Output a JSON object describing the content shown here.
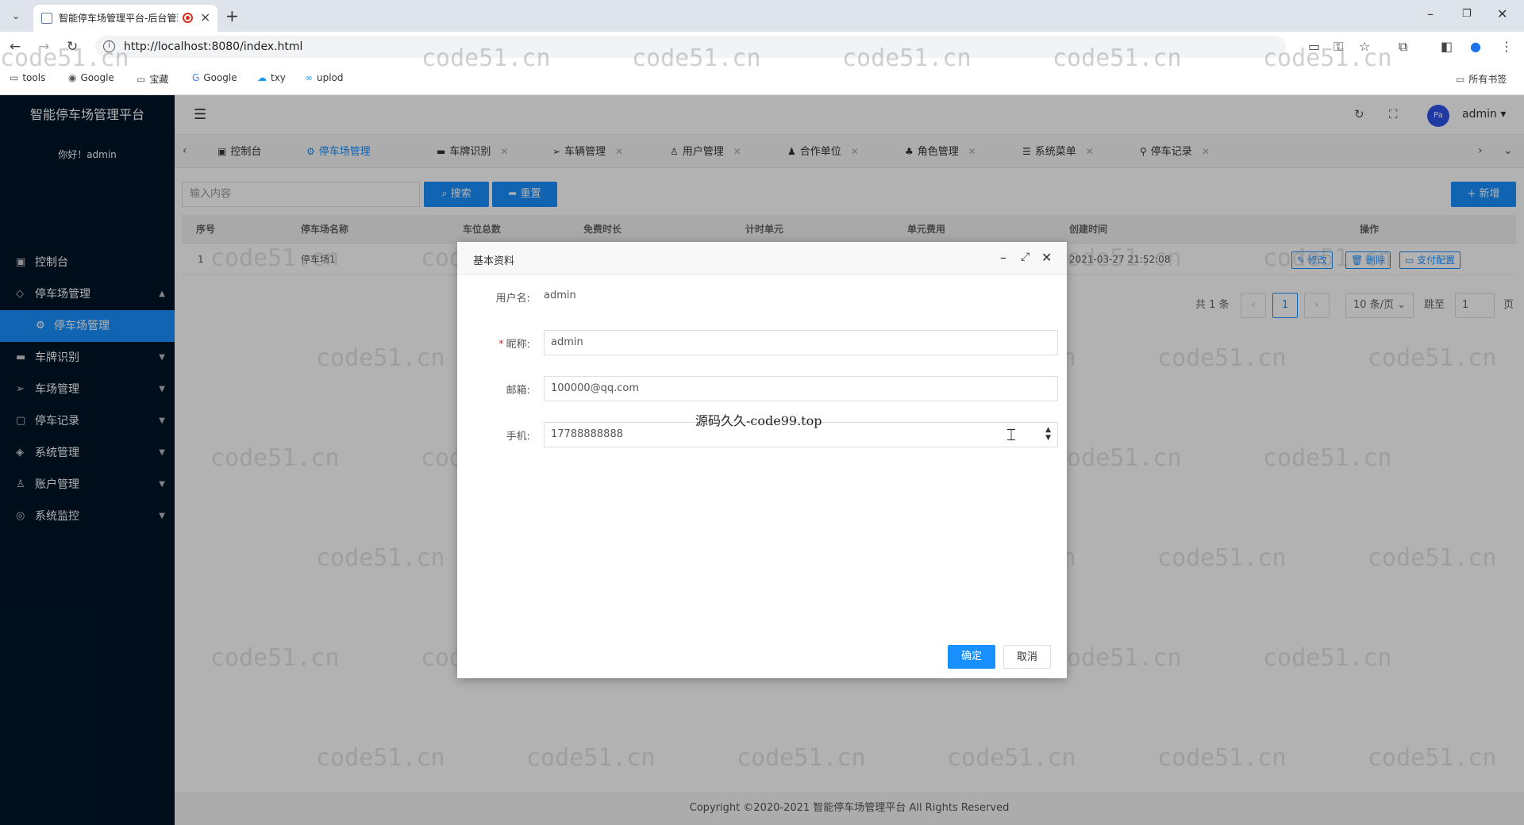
{
  "browser": {
    "tab_title": "智能停车场管理平台-后台管理",
    "url": "http://localhost:8080/index.html",
    "bookmarks": [
      "tools",
      "Google",
      "宝藏",
      "Google",
      "txy",
      "uplod"
    ],
    "all_bookmarks": "所有书签"
  },
  "app": {
    "logo": "智能停车场管理平台",
    "greeting": "你好！admin",
    "username": "admin",
    "avatar_text": "Pa"
  },
  "sidebar": {
    "items": [
      {
        "label": "控制台",
        "icon": "monitor-icon"
      },
      {
        "label": "停车场管理",
        "icon": "diamond-icon"
      },
      {
        "label": "停车场管理",
        "icon": "gear-icon"
      },
      {
        "label": "车牌识别",
        "icon": "camera-icon"
      },
      {
        "label": "车场管理",
        "icon": "send-icon"
      },
      {
        "label": "停车记录",
        "icon": "note-icon"
      },
      {
        "label": "系统管理",
        "icon": "layers-icon"
      },
      {
        "label": "账户管理",
        "icon": "user-icon"
      },
      {
        "label": "系统监控",
        "icon": "camera-icon"
      }
    ]
  },
  "tabs": [
    {
      "label": "控制台",
      "icon": "monitor-icon"
    },
    {
      "label": "停车场管理",
      "icon": "gear-icon"
    },
    {
      "label": "车牌识别",
      "icon": "camera-icon"
    },
    {
      "label": "车辆管理",
      "icon": "send-icon"
    },
    {
      "label": "用户管理",
      "icon": "user-icon"
    },
    {
      "label": "合作单位",
      "icon": "person-icon"
    },
    {
      "label": "角色管理",
      "icon": "tree-icon"
    },
    {
      "label": "系统菜单",
      "icon": "list-icon"
    },
    {
      "label": "停车记录",
      "icon": "pin-icon"
    }
  ],
  "toolbar": {
    "search_placeholder": "输入内容",
    "search_label": "搜索",
    "reset_label": "重置",
    "add_label": "新增"
  },
  "table": {
    "headers": [
      "序号",
      "停车场名称",
      "车位总数",
      "免费时长",
      "计时单元",
      "单元费用",
      "创建时间",
      "操作"
    ],
    "rows": [
      [
        "1",
        "停车场1",
        "",
        "",
        "",
        "",
        "2021-03-27 21:52:08"
      ]
    ],
    "actions": [
      "修改",
      "删除",
      "支付配置"
    ]
  },
  "pagination": {
    "total": "共 1 条",
    "current_page": "1",
    "page_size": "10 条/页",
    "jump_label": "跳至",
    "jump_value": "1",
    "page_suffix": "页"
  },
  "footer": "Copyright ©2020-2021 智能停车场管理平台 All Rights Reserved",
  "dialog": {
    "title": "基本资料",
    "username_label": "用户名:",
    "username_value": "admin",
    "nickname_label": "昵称:",
    "nickname_value": "admin",
    "email_label": "邮箱:",
    "email_value": "100000@qq.com",
    "phone_label": "手机:",
    "phone_value": "17788888888",
    "overlay_text": "源码久久-code99.top",
    "confirm_label": "确定",
    "cancel_label": "取消"
  },
  "watermark": "code51.cn"
}
